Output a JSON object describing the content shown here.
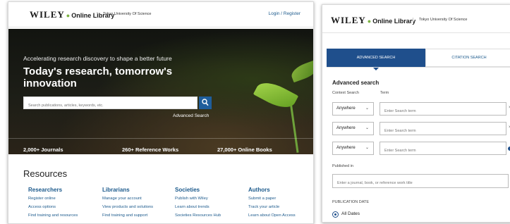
{
  "left": {
    "logo": {
      "brand": "WILEY",
      "product": "Online Library"
    },
    "institution": "Tokyo University Of Science",
    "login": "Login / Register",
    "hero": {
      "subtitle": "Accelerating research discovery to shape a better future",
      "title": "Today's research, tomorrow's innovation",
      "search_placeholder": "Search publications, articles, keywords, etc.",
      "advanced_search": "Advanced Search",
      "stats": [
        "2,000+ Journals",
        "260+ Reference Works",
        "27,000+ Online Books"
      ]
    },
    "resources": {
      "title": "Resources",
      "columns": [
        {
          "heading": "Researchers",
          "links": [
            "Register online",
            "Access options",
            "Find training and resources"
          ]
        },
        {
          "heading": "Librarians",
          "links": [
            "Manage your account",
            "View products and solutions",
            "Find training and support"
          ]
        },
        {
          "heading": "Societies",
          "links": [
            "Publish with Wiley",
            "Learn about trends",
            "Societies Resources Hub"
          ]
        },
        {
          "heading": "Authors",
          "links": [
            "Submit a paper",
            "Track your article",
            "Learn about Open Access"
          ]
        }
      ]
    }
  },
  "right": {
    "logo": {
      "brand": "WILEY",
      "product": "Online Library"
    },
    "institution": "Tokyo University Of Science",
    "tabs": [
      "ADVANCED SEARCH",
      "CITATION SEARCH"
    ],
    "heading": "Advanced search",
    "context_label": "Context Search",
    "term_label": "Term",
    "rows": [
      {
        "context": "Anywhere",
        "placeholder": "Enter Search term",
        "side": "×"
      },
      {
        "context": "Anywhere",
        "placeholder": "Enter Search term",
        "side": "×"
      },
      {
        "context": "Anywhere",
        "placeholder": "Enter Search term",
        "side": ""
      }
    ],
    "published_in_label": "Published in",
    "published_in_placeholder": "Enter a journal, book, or reference work title",
    "publication_date_label": "PUBLICATION DATE",
    "all_dates": "All Dates"
  }
}
